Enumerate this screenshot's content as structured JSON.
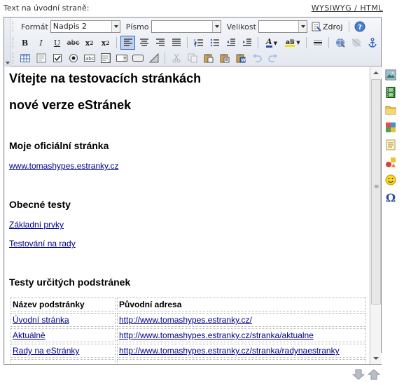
{
  "header": {
    "label": "Text na úvodní straně:",
    "mode_switch": "WYSIWYG / HTML"
  },
  "toolbar": {
    "format_label": "Formát",
    "format_value": "Nadpis 2",
    "font_label": "Písmo",
    "font_value": "",
    "size_label": "Velikost",
    "size_value": "",
    "source_label": "Zdroj",
    "bold": "B",
    "italic": "I",
    "underline": "U",
    "strike": "abc",
    "subscript": "x",
    "superscript": "x",
    "sub_mark": "2",
    "sup_mark": "2",
    "text_color": "A"
  },
  "content": {
    "title_line1": "Vítejte na testovacích stránkách",
    "title_line2": "nové verze eStránek",
    "section1_heading": "Moje oficiální stránka",
    "section1_link": "www.tomashypes.estranky.cz",
    "section2_heading": "Obecné testy",
    "section2_link1": "Základní prvky",
    "section2_link2": "Testování na rady",
    "section3_heading": "Testy určitých podstránek",
    "table": {
      "headers": [
        "Název podstránky",
        "Původní adresa"
      ],
      "rows": [
        [
          "Úvodní stránka",
          "http://www.tomashypes.estranky.cz/"
        ],
        [
          "Aktuálně",
          "http://www.tomashypes.estranky.cz/stranka/aktualne"
        ],
        [
          "Rady na eStránky",
          "http://www.tomashypes.estranky.cz/stranka/radynaestranky"
        ]
      ]
    }
  },
  "sidebar": {
    "icons": [
      "image-icon",
      "film-icon",
      "folder-icon",
      "photo-gallery-icon",
      "note-icon",
      "shapes-icon",
      "smiley-icon",
      "omega-icon"
    ],
    "omega_glyph": "Ω"
  },
  "colors": {
    "link": "#00008b",
    "accent": "#316ac5"
  }
}
